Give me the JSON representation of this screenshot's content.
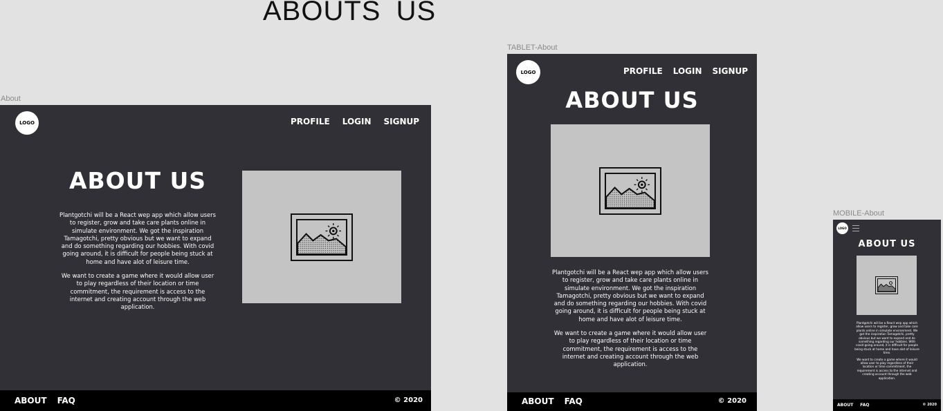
{
  "canvas_title": "ABOUTS US",
  "desktop": {
    "frame_label": "About",
    "logo": "LOGO",
    "nav": [
      "PROFILE",
      "LOGIN",
      "SIGNUP"
    ],
    "heading": "ABOUT US",
    "paragraph1": "Plantgotchi will be a React wep app which allow users to register, grow and take care plants online in simulate environment. We got the inspiration Tamagotchi,  pretty obvious but we want to expand and do something regarding our hobbies. With covid going around, it is difficult for people being stuck at home and have alot of leisure time.",
    "paragraph2": "We want to create a game where it would allow user to play regardless of their location or time commitment, the requirement is access to the internet and creating account through the web application.",
    "footer_links": [
      "ABOUT",
      "FAQ"
    ],
    "copyright": "© 2020"
  },
  "tablet": {
    "frame_label": "TABLET-About",
    "logo": "LOGO",
    "nav": [
      "PROFILE",
      "LOGIN",
      "SIGNUP"
    ],
    "heading": "ABOUT US",
    "paragraph1": "Plantgotchi will be a React wep app which allow users to register, grow and take care plants online in simulate environment. We got the inspiration Tamagotchi,  pretty obvious but we want to expand and do something regarding our hobbies. With covid going around, it is difficult for people being stuck at home and have alot of leisure time.",
    "paragraph2": "We want to create a game where it would allow user to play regardless of their location or time commitment, the requirement is access to the internet and creating account through the web application.",
    "footer_links": [
      "ABOUT",
      "FAQ"
    ],
    "copyright": "© 2020"
  },
  "mobile": {
    "frame_label": "MOBILE-About",
    "logo": "LOGO",
    "heading": "ABOUT US",
    "paragraph1": "Plantgotchi will be a React wep app which allow users to register, grow and take care plants online in simulate environment. We got the inspiration Tamagotchi,  pretty obvious but we want to expand and do something regarding our hobbies. With covid going around, it is difficult for people being stuck at home and have alot of leisure time.",
    "paragraph2": "We want to create a game where it would allow user to play regardless of their location or time commitment, the requirement is access to the internet and creating account through the web application.",
    "footer_links": [
      "ABOUT",
      "FAQ"
    ],
    "copyright": "© 2020"
  }
}
